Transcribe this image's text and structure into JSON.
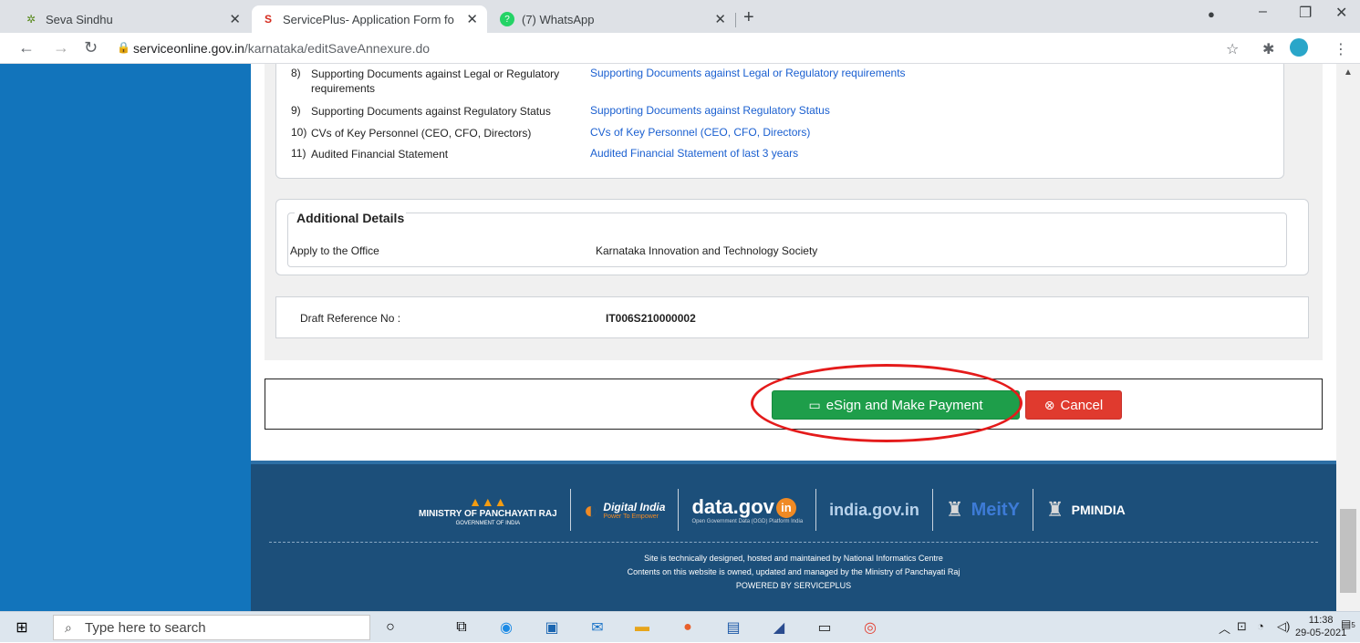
{
  "browser": {
    "tabs": [
      {
        "title": "Seva Sindhu",
        "icon": "leaf-favicon"
      },
      {
        "title": "ServicePlus- Application Form fo",
        "icon": "serviceplus-favicon"
      },
      {
        "title": "(7) WhatsApp",
        "icon": "whatsapp-favicon"
      }
    ],
    "url_host": "serviceonline.gov.in",
    "url_path": "/karnataka/editSaveAnnexure.do"
  },
  "documents": [
    {
      "num": "8)",
      "name": "Supporting Documents against Legal or Regulatory requirements",
      "link": "Supporting Documents against Legal or Regulatory requirements"
    },
    {
      "num": "9)",
      "name": "Supporting Documents against Regulatory Status",
      "link": "Supporting Documents against Regulatory Status"
    },
    {
      "num": "10)",
      "name": "CVs of Key Personnel (CEO, CFO, Directors)",
      "link": "CVs of Key Personnel (CEO, CFO, Directors)"
    },
    {
      "num": "11)",
      "name": "Audited Financial Statement",
      "link": "Audited Financial Statement of last 3 years"
    }
  ],
  "additional": {
    "legend": "Additional Details",
    "label": "Apply to the Office",
    "value": "Karnataka Innovation and Technology Society"
  },
  "draft": {
    "label": "Draft Reference No :",
    "value": "IT006S210000002"
  },
  "actions": {
    "esign_label": "eSign and Make Payment",
    "cancel_label": "Cancel"
  },
  "footer": {
    "logos": {
      "mopr": "MINISTRY OF PANCHAYATI RAJ",
      "mopr_sub": "GOVERNMENT OF INDIA",
      "digital_india": "Digital India",
      "digital_india_sub": "Power To Empower",
      "datagov": "data.gov",
      "datagov_sub": "Open Government Data (OGD) Platform India",
      "india_gov": "india.gov.in",
      "meity": "MeitY",
      "pmindia": "PMINDIA"
    },
    "line1": "Site is technically designed, hosted and maintained by National Informatics Centre",
    "line2": "Contents on this website is owned, updated and managed by the Ministry of Panchayati Raj",
    "line3": "POWERED BY SERVICEPLUS"
  },
  "taskbar": {
    "search_placeholder": "Type here to search",
    "time": "11:38",
    "date": "29-05-2021",
    "notif_count": "5"
  },
  "colors": {
    "sidebar": "#1274bb",
    "footer": "#1c4f7a",
    "esign_button": "#1e9e4a",
    "cancel_button": "#e03a2e",
    "annotation_ellipse": "#e41b1b"
  }
}
